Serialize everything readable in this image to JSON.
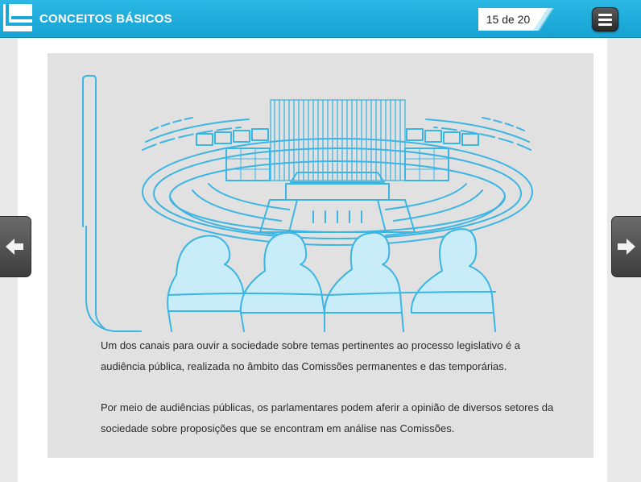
{
  "header": {
    "title": "CONCEITOS BÁSICOS",
    "page_indicator": "15 de 20",
    "menu_icon": "hamburger-menu-icon",
    "logo_icon": "course-logo-icon"
  },
  "navigation": {
    "prev_icon": "arrow-left-icon",
    "next_icon": "arrow-right-icon"
  },
  "content": {
    "illustration": "plenary-hearing-illustration",
    "paragraphs": [
      "Um dos canais para ouvir a sociedade sobre temas pertinentes ao processo legislativo é a audiência pública, realizada no âmbito das Comissões permanentes e das temporárias.",
      "Por meio de audiências públicas, os parlamentares podem aferir a opinião de diversos setores da sociedade sobre proposições que se encontram em análise nas Comissões."
    ]
  },
  "colors": {
    "header": "#1aa8d8",
    "illustration_line": "#3bb5e3",
    "panel": "#e1e1e1"
  }
}
